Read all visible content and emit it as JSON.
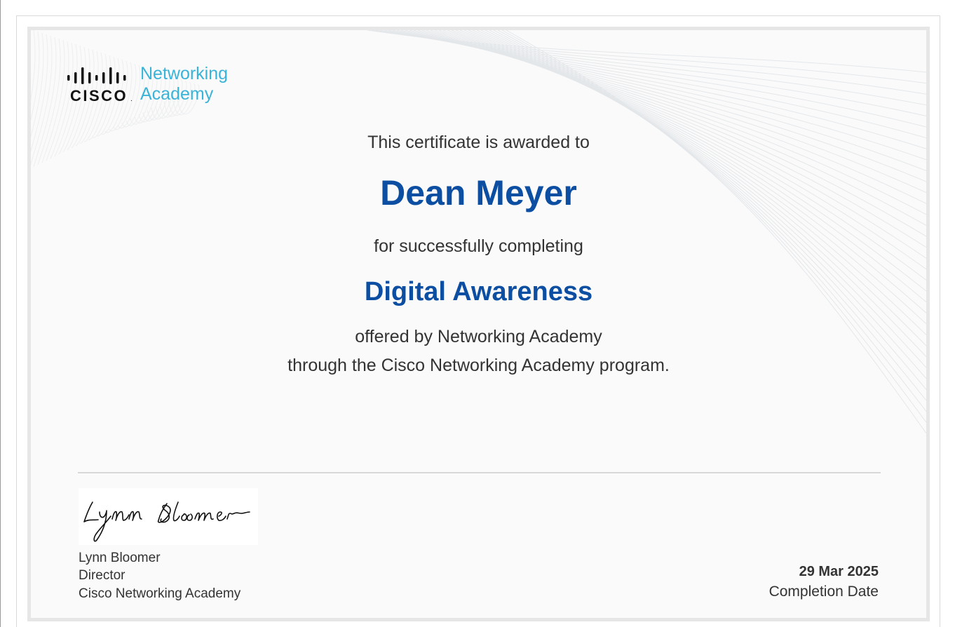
{
  "logo": {
    "brand": "CISCO",
    "line1": "Networking",
    "line2": "Academy",
    "accent_color": "#39b4d8"
  },
  "certificate": {
    "awarded_text": "This certificate is awarded to",
    "recipient": "Dean Meyer",
    "completing_text": "for successfully completing",
    "course": "Digital Awareness",
    "offered_text": "offered by Networking Academy",
    "program_text": "through the Cisco Networking Academy program.",
    "highlight_color": "#0b4ea2"
  },
  "signatory": {
    "signature": "Lynn Bloomer",
    "name": "Lynn Bloomer",
    "title": "Director",
    "organization": "Cisco Networking Academy"
  },
  "completion": {
    "date": "29 Mar 2025",
    "label": "Completion Date"
  }
}
